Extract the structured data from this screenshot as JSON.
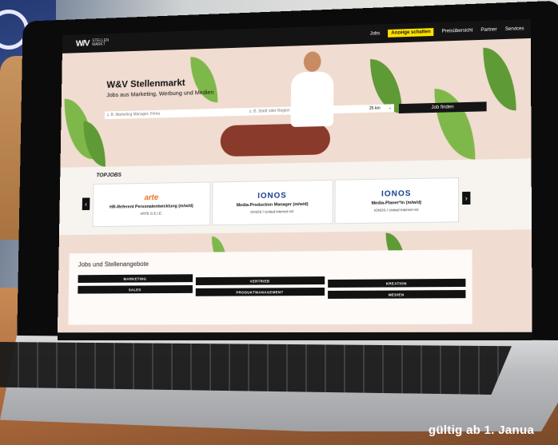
{
  "header": {
    "logo_mark": "W/V",
    "logo_text_line1": "STELLEN",
    "logo_text_line2": "MARKT",
    "nav": [
      "Jobs",
      "Anzeige schalten",
      "Preisübersicht",
      "Partner",
      "Services"
    ]
  },
  "hero": {
    "title": "W&V Stellenmarkt",
    "subtitle": "Jobs aus Marketing, Werbung und Medien",
    "what_placeholder": "z. B. Marketing Manager, Firma",
    "where_placeholder": "z. B. Stadt oder Region",
    "radius": "25 km",
    "search_button": "Job finden"
  },
  "topjobs": {
    "label": "TOPJOBS",
    "cards": [
      {
        "brand": "arte",
        "job": "HR-Referent Personalentwicklung (m/w/d)",
        "company": "ARTE G.E.I.E."
      },
      {
        "brand": "IONOS",
        "job": "Media-Production Manager (m/w/d)",
        "company": "IONOS / United Internet AG"
      },
      {
        "brand": "IONOS",
        "job": "Media-Planer*in (m/w/d)",
        "company": "IONOS / United Internet AG"
      }
    ],
    "prev": "‹",
    "next": "›"
  },
  "jobs": {
    "title": "Jobs und Stellenangebote",
    "categories": [
      "MARKETING",
      "VERTRIEB",
      "KREATION",
      "SALES",
      "PRODUKTMANAGEMENT",
      "MEDIEN"
    ]
  },
  "caption": "gültig ab 1. Janua"
}
